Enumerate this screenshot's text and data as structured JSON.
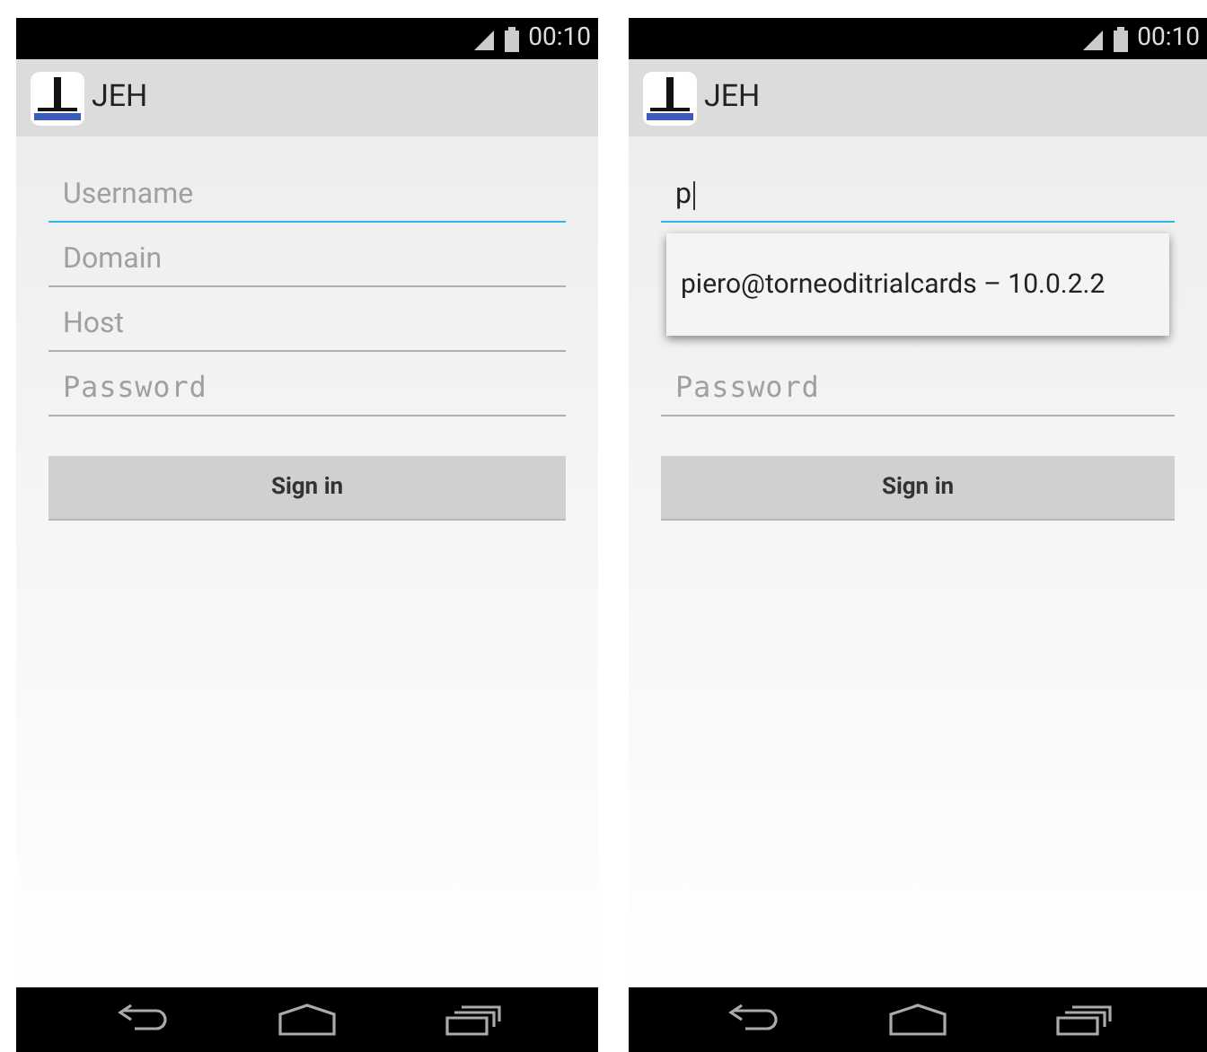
{
  "screens": [
    {
      "status_bar": {
        "time": "00:10"
      },
      "app_bar": {
        "title": "JEH"
      },
      "fields": [
        {
          "placeholder": "Username",
          "focused": true,
          "monospace": false
        },
        {
          "placeholder": "Domain",
          "focused": false,
          "monospace": false
        },
        {
          "placeholder": "Host",
          "focused": false,
          "monospace": false
        },
        {
          "placeholder": "Password",
          "focused": false,
          "monospace": true
        }
      ],
      "button": "Sign in"
    },
    {
      "status_bar": {
        "time": "00:10"
      },
      "app_bar": {
        "title": "JEH"
      },
      "fields": [
        {
          "value": "p",
          "focused": true,
          "monospace": false
        },
        {
          "placeholder": "Password",
          "focused": false,
          "monospace": true
        }
      ],
      "suggestions": [
        "piero@torneoditrialcards – 10.0.2.2"
      ],
      "button": "Sign in"
    }
  ]
}
